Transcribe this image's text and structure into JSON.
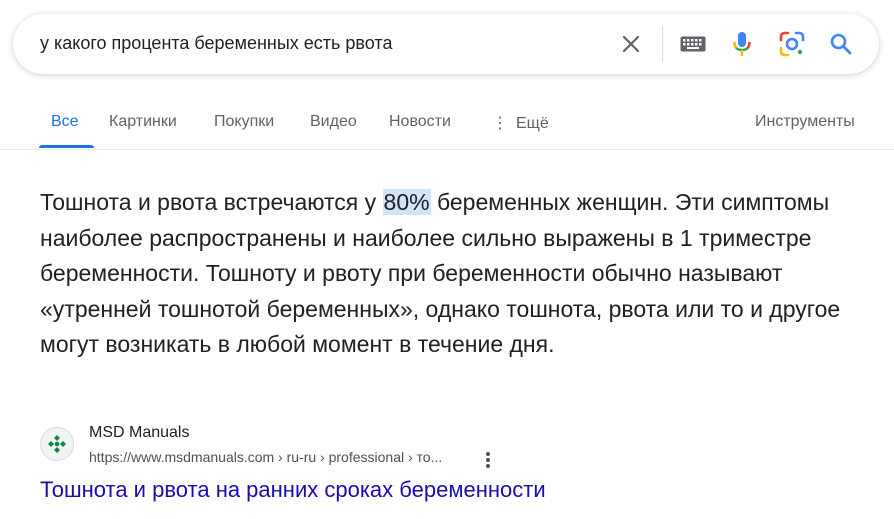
{
  "search": {
    "query": "у какого процента беременных есть рвота",
    "icons": [
      "close-icon",
      "keyboard-icon",
      "microphone-icon",
      "google-lens-icon",
      "search-icon"
    ]
  },
  "tabs": {
    "items": [
      {
        "label": "Все",
        "active": true
      },
      {
        "label": "Картинки"
      },
      {
        "label": "Покупки"
      },
      {
        "label": "Видео"
      },
      {
        "label": "Новости"
      },
      {
        "label": "Ещё",
        "icon": "more-vert-icon"
      }
    ],
    "tools_label": "Инструменты"
  },
  "snippet": {
    "before": "Тошнота и рвота встречаются у ",
    "highlight": "80%",
    "after": " беременных женщин. Эти симптомы наиболее распространены и наиболее сильно выражены в 1 триместре беременности. Тошноту и рвоту при беременности обычно называют «утренней тошнотой беременных», однако тошнота, рвота или то и другое могут возникать в любой момент в течение дня."
  },
  "source": {
    "name": "MSD Manuals",
    "url": "https://www.msdmanuals.com › ru-ru › professional › то...",
    "favicon": "msd-manuals-logo"
  },
  "result": {
    "title": "Тошнота и рвота на ранних сроках беременности"
  },
  "colors": {
    "accent": "#1a73e8",
    "link": "#1a0dab",
    "highlight_bg": "#d2e3fc",
    "text": "#202124",
    "muted": "#5f6368"
  }
}
